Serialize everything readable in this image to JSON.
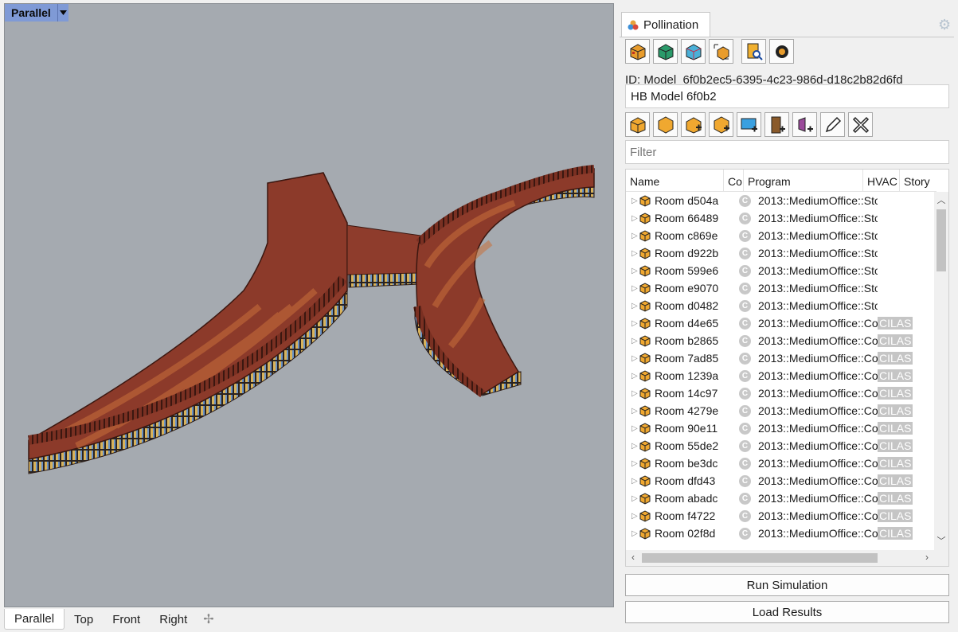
{
  "viewport": {
    "tab_label": "Parallel"
  },
  "view_tabs": [
    {
      "label": "Parallel",
      "active": true
    },
    {
      "label": "Top",
      "active": false
    },
    {
      "label": "Front",
      "active": false
    },
    {
      "label": "Right",
      "active": false
    }
  ],
  "panel": {
    "tab_label": "Pollination",
    "model_id": "ID: Model_6f0b2ec5-6395-4c23-986d-d18c2b82d6fd",
    "model_name": "HB Model 6f0b2",
    "filter_placeholder": "Filter",
    "columns": [
      "Name",
      "Co",
      "Program",
      "HVAC",
      "Story"
    ],
    "rooms": [
      {
        "name": "Room d504a",
        "program": "2013::MediumOffice::Sto",
        "hvac": ""
      },
      {
        "name": "Room 66489",
        "program": "2013::MediumOffice::Sto",
        "hvac": ""
      },
      {
        "name": "Room c869e",
        "program": "2013::MediumOffice::Sto",
        "hvac": ""
      },
      {
        "name": "Room d922b",
        "program": "2013::MediumOffice::Sto",
        "hvac": ""
      },
      {
        "name": "Room 599e6",
        "program": "2013::MediumOffice::Sto",
        "hvac": ""
      },
      {
        "name": "Room e9070",
        "program": "2013::MediumOffice::Sto",
        "hvac": ""
      },
      {
        "name": "Room d0482",
        "program": "2013::MediumOffice::Sto",
        "hvac": ""
      },
      {
        "name": "Room d4e65",
        "program": "2013::MediumOffice::Cor",
        "hvac": "CILAS"
      },
      {
        "name": "Room b2865",
        "program": "2013::MediumOffice::Cor",
        "hvac": "CILAS"
      },
      {
        "name": "Room 7ad85",
        "program": "2013::MediumOffice::Cor",
        "hvac": "CILAS"
      },
      {
        "name": "Room 1239a",
        "program": "2013::MediumOffice::Cor",
        "hvac": "CILAS"
      },
      {
        "name": "Room 14c97",
        "program": "2013::MediumOffice::Cor",
        "hvac": "CILAS"
      },
      {
        "name": "Room 4279e",
        "program": "2013::MediumOffice::Cor",
        "hvac": "CILAS"
      },
      {
        "name": "Room 90e11",
        "program": "2013::MediumOffice::Cor",
        "hvac": "CILAS"
      },
      {
        "name": "Room 55de2",
        "program": "2013::MediumOffice::Cor",
        "hvac": "CILAS"
      },
      {
        "name": "Room be3dc",
        "program": "2013::MediumOffice::Cor",
        "hvac": "CILAS"
      },
      {
        "name": "Room dfd43",
        "program": "2013::MediumOffice::Cor",
        "hvac": "CILAS"
      },
      {
        "name": "Room abadc",
        "program": "2013::MediumOffice::Cor",
        "hvac": "CILAS"
      },
      {
        "name": "Room f4722",
        "program": "2013::MediumOffice::Cor",
        "hvac": "CILAS"
      },
      {
        "name": "Room 02f8d",
        "program": "2013::MediumOffice::Cor",
        "hvac": "CILAS"
      }
    ],
    "run_simulation_label": "Run Simulation",
    "load_results_label": "Load Results"
  },
  "icons": {
    "toolbar_1": [
      "model-icon",
      "rooms-icon",
      "apertures-icon",
      "export-icon",
      "validate-report-icon",
      "settings-gear-icon"
    ],
    "toolbar_2": [
      "add-room-icon",
      "hex-room-icon",
      "add-room-plus-icon",
      "add-hex-plus-icon",
      "add-aperture-icon",
      "add-door-icon",
      "add-shade-icon",
      "edit-pencil-icon",
      "delete-icon"
    ]
  },
  "colors": {
    "model_fill": "#8c3a2a",
    "viewport_bg": "#a5aab0",
    "viewport_tab": "#7f9ad6"
  }
}
